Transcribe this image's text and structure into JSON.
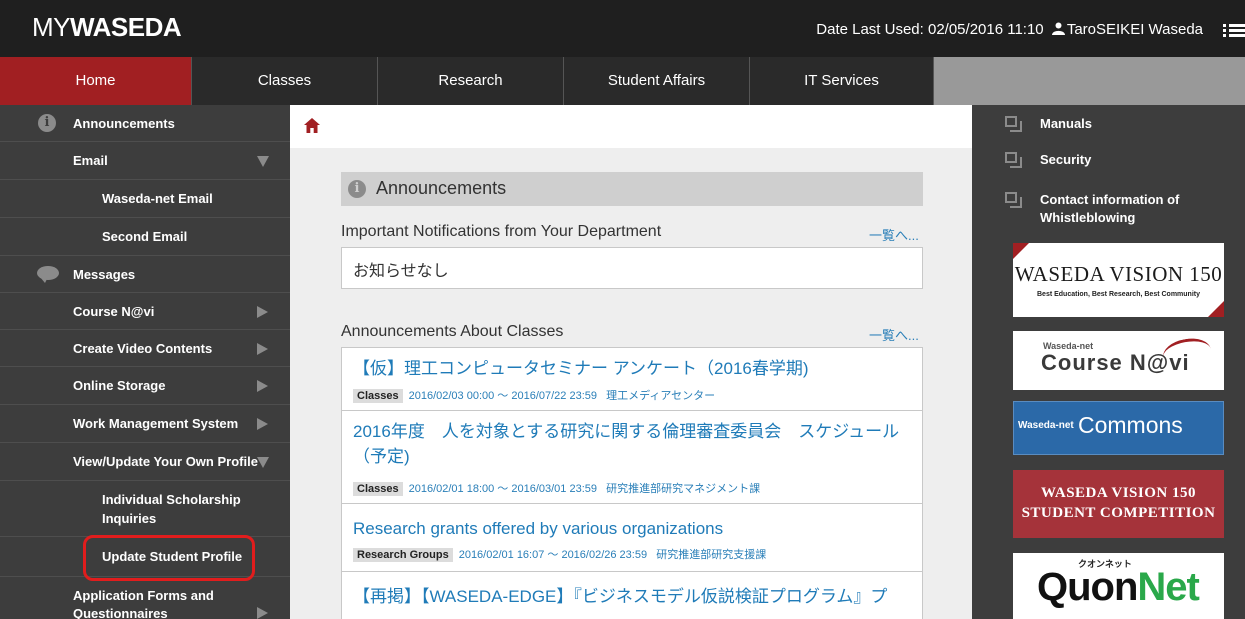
{
  "header": {
    "logo_my": "MY",
    "logo_waseda": "WASEDA",
    "date_last_used": "Date Last Used: 02/05/2016 11:10",
    "user_name": "TaroSEIKEI Waseda"
  },
  "nav": {
    "tabs": [
      "Home",
      "Classes",
      "Research",
      "Student Affairs",
      "IT Services"
    ],
    "active": "Home"
  },
  "sidebar": {
    "items": [
      {
        "label": "Announcements",
        "icon": "info-icon"
      },
      {
        "label": "Email",
        "caret": "down"
      },
      {
        "label": "Waseda-net Email"
      },
      {
        "label": "Second Email"
      },
      {
        "label": "Messages",
        "icon": "speech-bubble-icon"
      },
      {
        "label": "Course N@vi",
        "caret": "right"
      },
      {
        "label": "Create Video Contents",
        "caret": "right"
      },
      {
        "label": "Online Storage",
        "caret": "right"
      },
      {
        "label": "Work Management System",
        "caret": "right"
      },
      {
        "label": "View/Update Your Own Profile",
        "caret": "down"
      },
      {
        "label": "Individual Scholarship Inquiries"
      },
      {
        "label": "Update Student Profile"
      },
      {
        "label": "Application Forms and Questionnaires",
        "caret": "right"
      }
    ]
  },
  "main": {
    "announcements_title": "Announcements",
    "important": {
      "title": "Important Notifications from Your Department",
      "more": "一覧へ...",
      "empty_text": "お知らせなし"
    },
    "classes": {
      "title": "Announcements About Classes",
      "more": "一覧へ...",
      "items": [
        {
          "title": "【仮】理工コンピュータセミナー アンケート（2016春学期)",
          "badge": "Classes",
          "period": "2016/02/03 00:00 ～ 2016/07/22 23:59",
          "dept": "理工メディアセンター"
        },
        {
          "title": "2016年度　人を対象とする研究に関する倫理審査委員会　スケジュール（予定)",
          "badge": "Classes",
          "period": "2016/02/01 18:00 ～ 2016/03/01 23:59",
          "dept": "研究推進部研究マネジメント課"
        },
        {
          "title": "Research grants offered by various organizations",
          "badge": "Research Groups",
          "period": "2016/02/01 16:07 ～ 2016/02/26 23:59",
          "dept": "研究推進部研究支援課"
        },
        {
          "title": "【再掲】【WASEDA-EDGE】『ビジネスモデル仮説検証プログラム』プ"
        }
      ]
    }
  },
  "right": {
    "links": [
      "Manuals",
      "Security",
      "Contact information of Whistleblowing"
    ],
    "banners": {
      "vision": {
        "title": "WASEDA VISION 150",
        "sub": "Best Education, Best Research, Best Community"
      },
      "coursenavi": {
        "small": "Waseda-net",
        "big": "Course N@vi"
      },
      "commons": {
        "small": "Waseda-net",
        "big": "Commons"
      },
      "competition": {
        "line1": "WASEDA VISION 150",
        "line2": "STUDENT COMPETITION"
      },
      "quonnet": {
        "kana": "クオンネット",
        "q": "Quon",
        "n": "Net"
      }
    }
  },
  "colors": {
    "accent_red": "#a11f22",
    "header_bg": "#1f1f1f",
    "sidebar_bg": "#3d3d3d",
    "link_blue": "#1f7bb8",
    "highlight": "#e11d1d"
  }
}
